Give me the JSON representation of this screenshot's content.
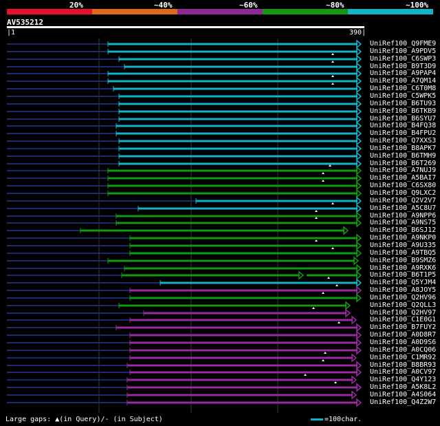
{
  "legend": {
    "labels": [
      "20%",
      "~40%",
      "~60%",
      "~80%",
      "~100%"
    ],
    "colors": [
      "#e8102a",
      "#e06818",
      "#902896",
      "#119a11",
      "#12b4c8"
    ]
  },
  "query": {
    "name": "AV535212",
    "start": "1",
    "end": "390"
  },
  "footer": {
    "gaps_text": "Large gaps: ▲(in Query)/- (in Subject)",
    "scale_text": "=100char."
  },
  "colors": {
    "cyan": "#12b4c8",
    "green": "#119a11",
    "purple": "#9a2aa0",
    "dashed": "#1c2a6c",
    "grid": "#3a3a3a"
  },
  "hits": [
    {
      "name": "UniRef100_Q9FME9",
      "start": 157,
      "color": "cyan",
      "gap": null
    },
    {
      "name": "UniRef100_A9PDV5",
      "start": 157,
      "color": "cyan",
      "gap": null
    },
    {
      "name": "UniRef100_C6SWP3",
      "start": 173,
      "color": "cyan",
      "gap": 484
    },
    {
      "name": "UniRef100_B9T3D9",
      "start": 181,
      "color": "cyan",
      "gap": 484
    },
    {
      "name": "UniRef100_A9PAP4",
      "start": 157,
      "color": "cyan",
      "gap": null
    },
    {
      "name": "UniRef100_A7QM14",
      "start": 157,
      "color": "cyan",
      "gap": 484
    },
    {
      "name": "UniRef100_C6T0M8",
      "start": 165,
      "color": "cyan",
      "gap": 484
    },
    {
      "name": "UniRef100_C5WPK5",
      "start": 173,
      "color": "cyan",
      "gap": null
    },
    {
      "name": "UniRef100_B6TU93",
      "start": 173,
      "color": "cyan",
      "gap": null
    },
    {
      "name": "UniRef100_B6TKB9",
      "start": 173,
      "color": "cyan",
      "gap": null
    },
    {
      "name": "UniRef100_B6SYU7",
      "start": 173,
      "color": "cyan",
      "gap": null
    },
    {
      "name": "UniRef100_B4FQ38",
      "start": 169,
      "color": "cyan",
      "gap": null
    },
    {
      "name": "UniRef100_B4FPU2",
      "start": 169,
      "color": "cyan",
      "gap": null
    },
    {
      "name": "UniRef100_Q7XXS3",
      "start": 173,
      "color": "cyan",
      "gap": null
    },
    {
      "name": "UniRef100_B8APK7",
      "start": 173,
      "color": "cyan",
      "gap": null
    },
    {
      "name": "UniRef100_B6TMH9",
      "start": 173,
      "color": "cyan",
      "gap": null
    },
    {
      "name": "UniRef100_B6T269",
      "start": 173,
      "color": "cyan",
      "gap": null
    },
    {
      "name": "UniRef100_A7NUJ9",
      "start": 157,
      "color": "green",
      "gap": 480
    },
    {
      "name": "UniRef100_A5BAI7",
      "start": 157,
      "color": "green",
      "gap": 470
    },
    {
      "name": "UniRef100_C6SX80",
      "start": 157,
      "color": "green",
      "gap": 470
    },
    {
      "name": "UniRef100_Q9LXC2",
      "start": 157,
      "color": "green",
      "gap": null
    },
    {
      "name": "UniRef100_Q2V2V7",
      "start": 285,
      "color": "cyan",
      "gap": null
    },
    {
      "name": "UniRef100_A5C8U7",
      "start": 201,
      "color": "cyan",
      "gap": 484
    },
    {
      "name": "UniRef100_A9NPP6",
      "start": 169,
      "color": "green",
      "gap": 460
    },
    {
      "name": "UniRef100_A9NS75",
      "start": 169,
      "color": "green",
      "gap": 460
    },
    {
      "name": "UniRef100_B6SJ12",
      "start": 117,
      "color": "green",
      "gap": null,
      "end": 505
    },
    {
      "name": "UniRef100_A9NKP0",
      "start": 189,
      "color": "green",
      "gap": null
    },
    {
      "name": "UniRef100_A9U335",
      "start": 189,
      "color": "green",
      "gap": 460
    },
    {
      "name": "UniRef100_A9TBQ5",
      "start": 189,
      "color": "green",
      "gap": 484
    },
    {
      "name": "UniRef100_B9SMZ6",
      "start": 157,
      "color": "green",
      "gap": null,
      "end": 520
    },
    {
      "name": "UniRef100_A9RXK6",
      "start": 181,
      "color": "green",
      "gap": null
    },
    {
      "name": "UniRef100_B6T1P5",
      "start": 177,
      "color": "green",
      "gap": null,
      "break": 440
    },
    {
      "name": "UniRef100_Q5YJM4",
      "start": 233,
      "color": "cyan",
      "gap": 478
    },
    {
      "name": "UniRef100_A8JOY5",
      "start": 189,
      "color": "purple",
      "gap": 490
    },
    {
      "name": "UniRef100_Q2HV96",
      "start": 189,
      "color": "green",
      "gap": 470
    },
    {
      "name": "UniRef100_Q2QLL3",
      "start": 173,
      "color": "green",
      "gap": null,
      "end": 508
    },
    {
      "name": "UniRef100_Q2HV97",
      "start": 209,
      "color": "purple",
      "gap": 456,
      "end": 508
    },
    {
      "name": "UniRef100_C1E0G1",
      "start": 189,
      "color": "purple",
      "gap": null,
      "end": 517
    },
    {
      "name": "UniRef100_B7FUY2",
      "start": 169,
      "color": "purple",
      "gap": 493
    },
    {
      "name": "UniRef100_A0D8R7",
      "start": 189,
      "color": "purple",
      "gap": null
    },
    {
      "name": "UniRef100_A0D9S6",
      "start": 189,
      "color": "purple",
      "gap": null
    },
    {
      "name": "UniRef100_A0CQ06",
      "start": 189,
      "color": "purple",
      "gap": null
    },
    {
      "name": "UniRef100_C1MR92",
      "start": 189,
      "color": "purple",
      "gap": 473,
      "end": 517
    },
    {
      "name": "UniRef100_B8BR93",
      "start": 185,
      "color": "purple",
      "gap": 470
    },
    {
      "name": "UniRef100_A0CV97",
      "start": 189,
      "color": "purple",
      "gap": null
    },
    {
      "name": "UniRef100_Q4Y123",
      "start": 185,
      "color": "purple",
      "gap": 444,
      "end": 517
    },
    {
      "name": "UniRef100_A5K8L2",
      "start": 185,
      "color": "purple",
      "gap": 488
    },
    {
      "name": "UniRef100_A4S064",
      "start": 185,
      "color": "purple",
      "gap": null,
      "end": 517
    },
    {
      "name": "UniRef100_Q4Z2W7",
      "start": 185,
      "color": "purple",
      "gap": null
    }
  ]
}
